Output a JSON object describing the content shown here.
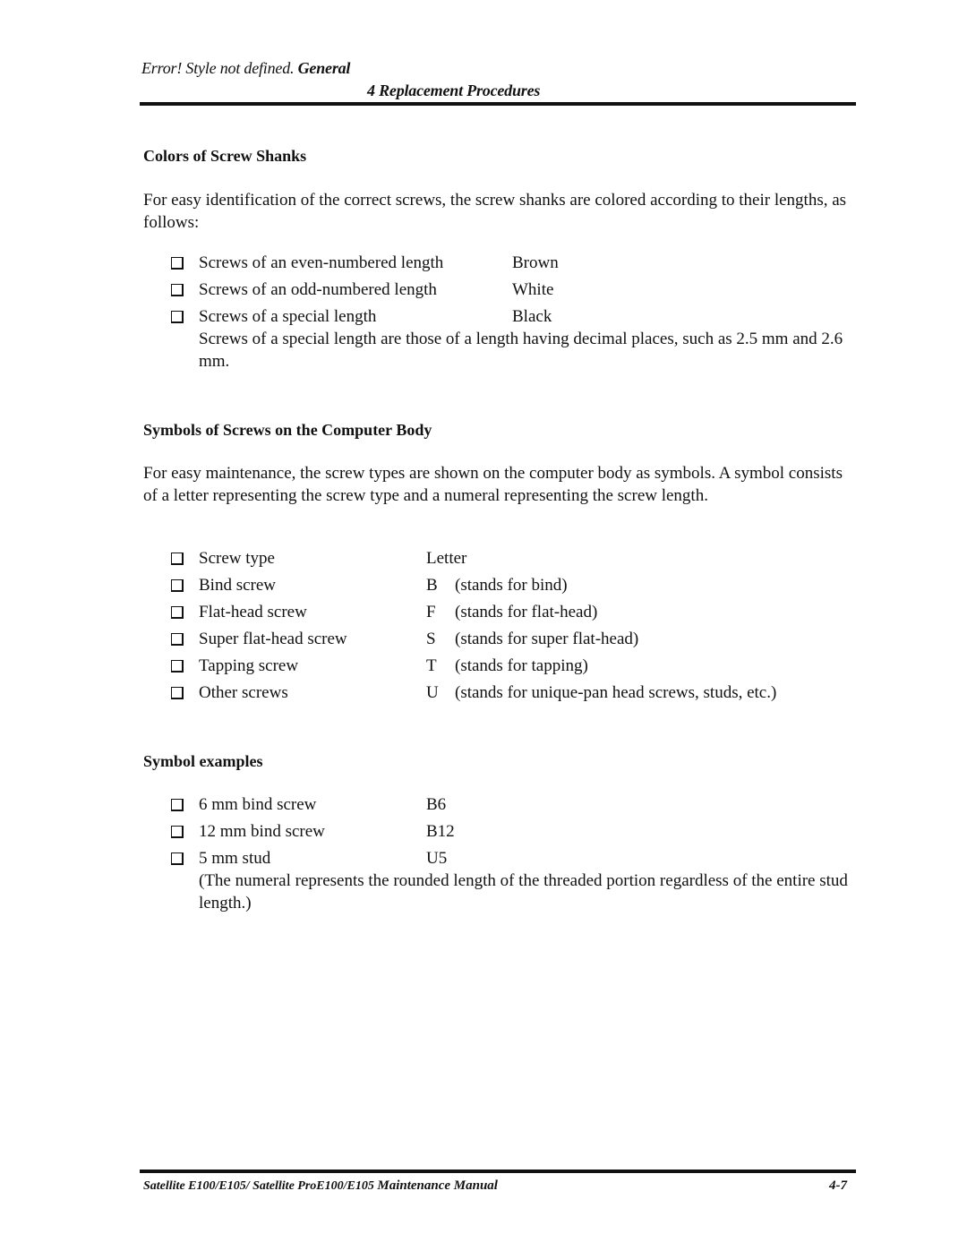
{
  "header": {
    "error_text": "Error! Style not defined.",
    "chapter_word": "General",
    "section_title": "4 Replacement Procedures"
  },
  "colors_section": {
    "heading": "Colors of Screw Shanks",
    "intro": "For easy identification of the correct screws, the screw shanks are colored according to their lengths, as follows:",
    "items": [
      {
        "label": "Screws of an even-numbered length",
        "value": "Brown"
      },
      {
        "label": "Screws of an odd-numbered length",
        "value": "White"
      },
      {
        "label": "Screws of a special length",
        "value": "Black"
      }
    ],
    "note": "Screws of a special length are those of a length having decimal places, such as 2.5 mm and 2.6 mm."
  },
  "symbols_section": {
    "heading": "Symbols of Screws on the Computer Body",
    "intro": "For easy maintenance, the screw types are shown on the computer body as symbols. A symbol consists of a letter representing the screw type and a numeral representing the screw length.",
    "items": [
      {
        "label": "Screw type",
        "letter": "Letter",
        "desc": ""
      },
      {
        "label": "Bind screw",
        "letter": "B",
        "desc": "(stands for bind)"
      },
      {
        "label": "Flat-head screw",
        "letter": "F",
        "desc": "(stands for flat-head)"
      },
      {
        "label": "Super flat-head screw",
        "letter": "S",
        "desc": "(stands for super flat-head)"
      },
      {
        "label": "Tapping screw",
        "letter": "T",
        "desc": "(stands for tapping)"
      },
      {
        "label": "Other screws",
        "letter": "U",
        "desc": "(stands for unique-pan head screws, studs, etc.)"
      }
    ]
  },
  "examples_section": {
    "heading": "Symbol examples",
    "items": [
      {
        "label": "6 mm bind screw",
        "symbol": "B6"
      },
      {
        "label": "12 mm bind screw",
        "symbol": "B12"
      },
      {
        "label": "5 mm stud",
        "symbol": "U5"
      }
    ],
    "note": "(The numeral represents the rounded length of the threaded portion regardless of the entire stud length.)"
  },
  "footer": {
    "model_text": "Satellite E100/E105/ Satellite ProE100/E105",
    "manual_text": "Maintenance Manual",
    "page_number": "4-7"
  }
}
